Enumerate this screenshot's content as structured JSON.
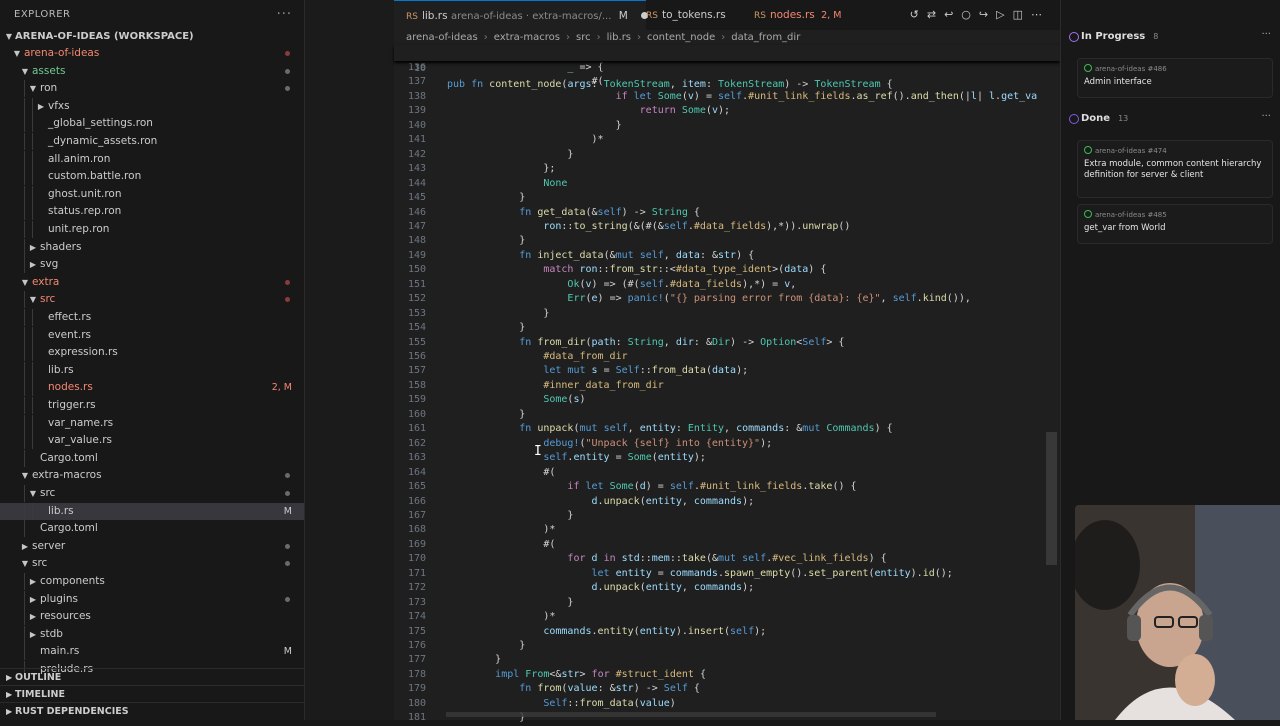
{
  "explorer": {
    "title": "EXPLORER",
    "workspace": "ARENA-OF-IDEAS (WORKSPACE)",
    "tree": [
      {
        "label": "arena-of-ideas",
        "indent": 1,
        "chev": "v",
        "color": "red",
        "dot": "red"
      },
      {
        "label": "assets",
        "indent": 2,
        "chev": "v",
        "color": "green",
        "dot": "grey"
      },
      {
        "label": "ron",
        "indent": 3,
        "chev": "v",
        "color": "",
        "dot": "grey"
      },
      {
        "label": "vfxs",
        "indent": 4,
        "chev": ">",
        "color": "",
        "dot": ""
      },
      {
        "label": "_global_settings.ron",
        "indent": 4,
        "chev": "",
        "color": "",
        "dot": ""
      },
      {
        "label": "_dynamic_assets.ron",
        "indent": 4,
        "chev": "",
        "color": "",
        "dot": ""
      },
      {
        "label": "all.anim.ron",
        "indent": 4,
        "chev": "",
        "color": "",
        "dot": ""
      },
      {
        "label": "custom.battle.ron",
        "indent": 4,
        "chev": "",
        "color": "",
        "dot": ""
      },
      {
        "label": "ghost.unit.ron",
        "indent": 4,
        "chev": "",
        "color": "",
        "dot": ""
      },
      {
        "label": "status.rep.ron",
        "indent": 4,
        "chev": "",
        "color": "",
        "dot": ""
      },
      {
        "label": "unit.rep.ron",
        "indent": 4,
        "chev": "",
        "color": "",
        "dot": ""
      },
      {
        "label": "shaders",
        "indent": 3,
        "chev": ">",
        "color": "",
        "dot": ""
      },
      {
        "label": "svg",
        "indent": 3,
        "chev": ">",
        "color": "",
        "dot": ""
      },
      {
        "label": "extra",
        "indent": 2,
        "chev": "v",
        "color": "red",
        "dot": "red"
      },
      {
        "label": "src",
        "indent": 3,
        "chev": "v",
        "color": "red",
        "dot": "red"
      },
      {
        "label": "effect.rs",
        "indent": 4,
        "chev": "",
        "color": "",
        "dot": ""
      },
      {
        "label": "event.rs",
        "indent": 4,
        "chev": "",
        "color": "",
        "dot": ""
      },
      {
        "label": "expression.rs",
        "indent": 4,
        "chev": "",
        "color": "",
        "dot": ""
      },
      {
        "label": "lib.rs",
        "indent": 4,
        "chev": "",
        "color": "",
        "dot": ""
      },
      {
        "label": "nodes.rs",
        "indent": 4,
        "chev": "",
        "color": "red",
        "dot": "",
        "badge": "2, M"
      },
      {
        "label": "trigger.rs",
        "indent": 4,
        "chev": "",
        "color": "",
        "dot": ""
      },
      {
        "label": "var_name.rs",
        "indent": 4,
        "chev": "",
        "color": "",
        "dot": ""
      },
      {
        "label": "var_value.rs",
        "indent": 4,
        "chev": "",
        "color": "",
        "dot": ""
      },
      {
        "label": "Cargo.toml",
        "indent": 3,
        "chev": "",
        "color": "",
        "dot": ""
      },
      {
        "label": "extra-macros",
        "indent": 2,
        "chev": "v",
        "color": "",
        "dot": "grey"
      },
      {
        "label": "src",
        "indent": 3,
        "chev": "v",
        "color": "",
        "dot": "grey"
      },
      {
        "label": "lib.rs",
        "indent": 4,
        "chev": "",
        "color": "",
        "dot": "",
        "badge": "M",
        "selected": true
      },
      {
        "label": "Cargo.toml",
        "indent": 3,
        "chev": "",
        "color": "",
        "dot": ""
      },
      {
        "label": "server",
        "indent": 2,
        "chev": ">",
        "color": "",
        "dot": "grey"
      },
      {
        "label": "src",
        "indent": 2,
        "chev": "v",
        "color": "",
        "dot": "grey"
      },
      {
        "label": "components",
        "indent": 3,
        "chev": ">",
        "color": "",
        "dot": ""
      },
      {
        "label": "plugins",
        "indent": 3,
        "chev": ">",
        "color": "",
        "dot": "grey"
      },
      {
        "label": "resources",
        "indent": 3,
        "chev": ">",
        "color": "",
        "dot": ""
      },
      {
        "label": "stdb",
        "indent": 3,
        "chev": ">",
        "color": "",
        "dot": ""
      },
      {
        "label": "main.rs",
        "indent": 3,
        "chev": "",
        "color": "",
        "dot": "",
        "badge": "M"
      },
      {
        "label": "prelude.rs",
        "indent": 3,
        "chev": "",
        "color": "",
        "dot": ""
      }
    ],
    "sections": [
      "OUTLINE",
      "TIMELINE",
      "RUST DEPENDENCIES"
    ]
  },
  "tabs": [
    {
      "label": "lib.rs",
      "desc": "arena-of-ideas · extra-macros/...",
      "status": "M",
      "active": true
    },
    {
      "label": "to_tokens.rs",
      "desc": "",
      "status": "",
      "active": false
    },
    {
      "label": "nodes.rs",
      "desc": "",
      "status": "2, M",
      "active": false
    }
  ],
  "breadcrumb": [
    "arena-of-ideas",
    "extra-macros",
    "src",
    "lib.rs",
    "content_node",
    "data_from_dir"
  ],
  "sticky": {
    "line": "10",
    "code": "pub fn content_node(args: TokenStream, item: TokenStream) -> TokenStream {"
  },
  "code_lines": [
    {
      "n": "136",
      "t": "                    _ => {"
    },
    {
      "n": "137",
      "t": "                        #("
    },
    {
      "n": "138",
      "t": "                            if let Some(v) = self.#unit_link_fields.as_ref().and_then(|l| l.get_va"
    },
    {
      "n": "139",
      "t": "                                return Some(v);"
    },
    {
      "n": "140",
      "t": "                            }"
    },
    {
      "n": "141",
      "t": "                        )*"
    },
    {
      "n": "142",
      "t": "                    }"
    },
    {
      "n": "143",
      "t": "                };"
    },
    {
      "n": "144",
      "t": "                None"
    },
    {
      "n": "145",
      "t": "            }"
    },
    {
      "n": "146",
      "t": "            fn get_data(&self) -> String {"
    },
    {
      "n": "147",
      "t": "                ron::to_string(&(#(&self.#data_fields),*)).unwrap()"
    },
    {
      "n": "148",
      "t": "            }"
    },
    {
      "n": "149",
      "t": "            fn inject_data(&mut self, data: &str) {"
    },
    {
      "n": "150",
      "t": "                match ron::from_str::<#data_type_ident>(data) {"
    },
    {
      "n": "151",
      "t": "                    Ok(v) => (#(self.#data_fields),*) = v,"
    },
    {
      "n": "152",
      "t": "                    Err(e) => panic!(\"{} parsing error from {data}: {e}\", self.kind()),"
    },
    {
      "n": "153",
      "t": "                }"
    },
    {
      "n": "154",
      "t": "            }"
    },
    {
      "n": "155",
      "t": "            fn from_dir(path: String, dir: &Dir) -> Option<Self> {"
    },
    {
      "n": "156",
      "t": "                #data_from_dir"
    },
    {
      "n": "157",
      "t": "                let mut s = Self::from_data(data);"
    },
    {
      "n": "158",
      "t": "                #inner_data_from_dir"
    },
    {
      "n": "159",
      "t": "                Some(s)"
    },
    {
      "n": "160",
      "t": "            }"
    },
    {
      "n": "161",
      "t": "            fn unpack(mut self, entity: Entity, commands: &mut Commands) {"
    },
    {
      "n": "162",
      "t": "                debug!(\"Unpack {self} into {entity}\");"
    },
    {
      "n": "163",
      "t": "                self.entity = Some(entity);"
    },
    {
      "n": "164",
      "t": "                #("
    },
    {
      "n": "165",
      "t": "                    if let Some(d) = self.#unit_link_fields.take() {"
    },
    {
      "n": "166",
      "t": "                        d.unpack(entity, commands);"
    },
    {
      "n": "167",
      "t": "                    }"
    },
    {
      "n": "168",
      "t": "                )*"
    },
    {
      "n": "169",
      "t": "                #("
    },
    {
      "n": "170",
      "t": "                    for d in std::mem::take(&mut self.#vec_link_fields) {"
    },
    {
      "n": "171",
      "t": "                        let entity = commands.spawn_empty().set_parent(entity).id();"
    },
    {
      "n": "172",
      "t": "                        d.unpack(entity, commands);"
    },
    {
      "n": "173",
      "t": "                    }"
    },
    {
      "n": "174",
      "t": "                )*"
    },
    {
      "n": "175",
      "t": "                commands.entity(entity).insert(self);"
    },
    {
      "n": "176",
      "t": "            }"
    },
    {
      "n": "177",
      "t": "        }"
    },
    {
      "n": "178",
      "t": "        impl From<&str> for #struct_ident {"
    },
    {
      "n": "179",
      "t": "            fn from(value: &str) -> Self {"
    },
    {
      "n": "180",
      "t": "                Self::from_data(value)"
    },
    {
      "n": "181",
      "t": "            }"
    }
  ],
  "projects": {
    "groups": [
      {
        "name": "In Progress",
        "count": "8",
        "cards": [
          {
            "meta": "arena-of-ideas #486",
            "title": "Admin interface"
          }
        ]
      },
      {
        "name": "Done",
        "count": "13",
        "cards": [
          {
            "meta": "arena-of-ideas #474",
            "title": "Extra module, common content hierarchy definition for server & client"
          },
          {
            "meta": "arena-of-ideas #485",
            "title": "get_var from World"
          }
        ]
      }
    ]
  },
  "colors": {
    "accent": "#0078d4",
    "modified": "#f48771",
    "untracked": "#73c991"
  }
}
